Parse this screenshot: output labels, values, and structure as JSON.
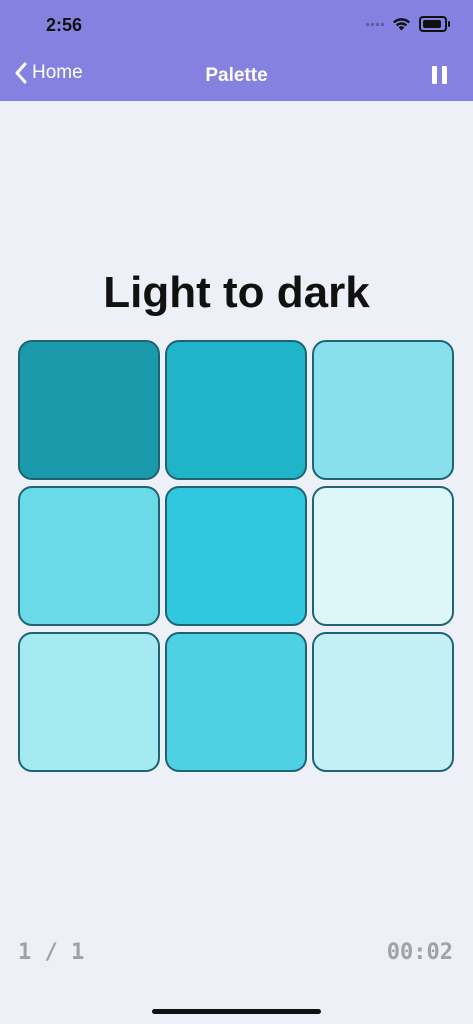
{
  "status_bar": {
    "time": "2:56"
  },
  "nav": {
    "back_label": "Home",
    "title": "Palette"
  },
  "puzzle": {
    "heading": "Light to dark",
    "tiles": [
      "#1a9aab",
      "#1fb4c8",
      "#87e0ec",
      "#6adae8",
      "#30c8de",
      "#ddf6f8",
      "#a6eaf1",
      "#4ed2e3",
      "#c4eff4"
    ]
  },
  "footer": {
    "progress": "1 / 1",
    "timer": "00:02"
  },
  "colors": {
    "nav_background": "#8581e0",
    "page_background": "#eef0f7",
    "tile_border": "#1e6474"
  }
}
